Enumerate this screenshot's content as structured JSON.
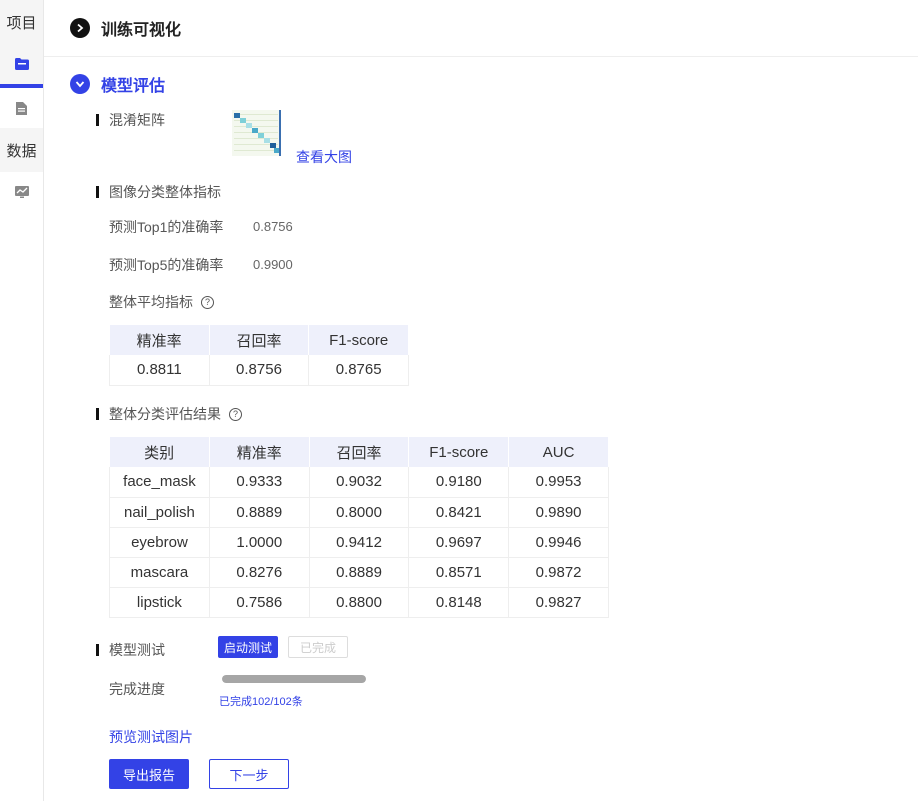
{
  "sidebar": {
    "project_label": "项目",
    "data_label": "数据"
  },
  "sections": {
    "training_viz": "训练可视化",
    "model_eval": "模型评估"
  },
  "confusion": {
    "label": "混淆矩阵",
    "view_large": "查看大图"
  },
  "overall": {
    "label": "图像分类整体指标",
    "top1_label": "预测Top1的准确率",
    "top1_value": "0.8756",
    "top5_label": "预测Top5的准确率",
    "top5_value": "0.9900",
    "avg_label": "整体平均指标",
    "help_glyph": "?"
  },
  "avg_table": {
    "headers": [
      "精准率",
      "召回率",
      "F1-score"
    ],
    "row": [
      "0.8811",
      "0.8756",
      "0.8765"
    ]
  },
  "class_eval": {
    "label": "整体分类评估结果",
    "headers": [
      "类别",
      "精准率",
      "召回率",
      "F1-score",
      "AUC"
    ],
    "rows": [
      [
        "face_mask",
        "0.9333",
        "0.9032",
        "0.9180",
        "0.9953"
      ],
      [
        "nail_polish",
        "0.8889",
        "0.8000",
        "0.8421",
        "0.9890"
      ],
      [
        "eyebrow",
        "1.0000",
        "0.9412",
        "0.9697",
        "0.9946"
      ],
      [
        "mascara",
        "0.8276",
        "0.8889",
        "0.8571",
        "0.9872"
      ],
      [
        "lipstick",
        "0.7586",
        "0.8800",
        "0.8148",
        "0.9827"
      ]
    ]
  },
  "model_test": {
    "label": "模型测试",
    "start_button": "启动测试",
    "done_button": "已完成",
    "progress_label": "完成进度",
    "progress_fraction": 1.0,
    "progress_text": "已完成102/102条",
    "preview_link": "预览测试图片"
  },
  "actions": {
    "export": "导出报告",
    "next": "下一步"
  },
  "colors": {
    "accent": "#3342e6",
    "header_bg": "#eef0fb"
  }
}
